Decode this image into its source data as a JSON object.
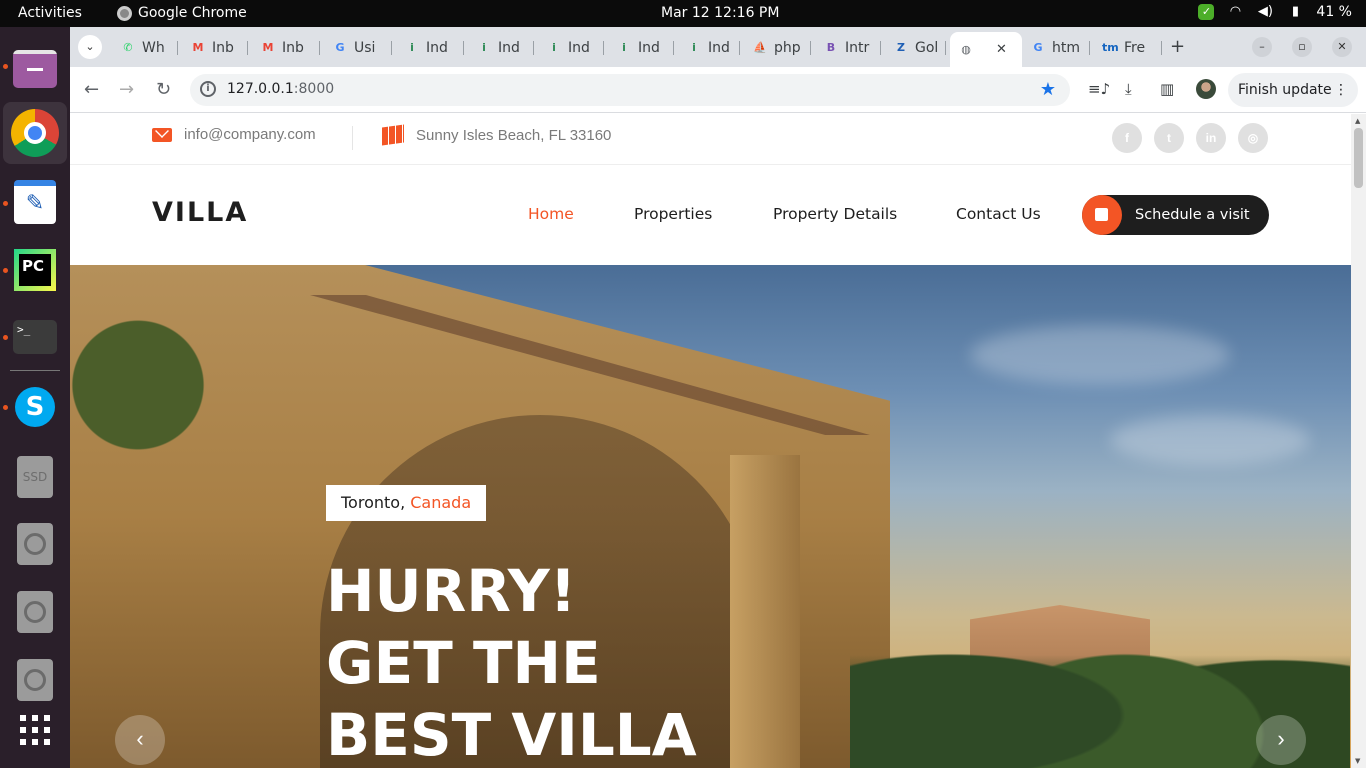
{
  "system": {
    "activities": "Activities",
    "app_name": "Google Chrome",
    "clock": "Mar 12  12:16 PM",
    "battery": "41 %"
  },
  "browser": {
    "tabs": [
      {
        "label": "Wh",
        "icon": "whatsapp-icon",
        "color": "#25d366"
      },
      {
        "label": "Inb",
        "icon": "gmail-icon",
        "color": "#ea4335"
      },
      {
        "label": "Inb",
        "icon": "gmail-icon",
        "color": "#ea4335"
      },
      {
        "label": "Usi",
        "icon": "google-icon",
        "color": "#4285f4"
      },
      {
        "label": "Ind",
        "icon": "indeed-icon",
        "color": "#2e8b57"
      },
      {
        "label": "Ind",
        "icon": "indeed-icon",
        "color": "#2e8b57"
      },
      {
        "label": "Ind",
        "icon": "indeed-icon",
        "color": "#2e8b57"
      },
      {
        "label": "Ind",
        "icon": "indeed-icon",
        "color": "#2e8b57"
      },
      {
        "label": "Ind",
        "icon": "indeed-icon",
        "color": "#2e8b57"
      },
      {
        "label": "php",
        "icon": "phpmyadmin-icon",
        "color": "#f29111"
      },
      {
        "label": "Intr",
        "icon": "bootstrap-icon",
        "color": "#7952b3"
      },
      {
        "label": "Gol",
        "icon": "golang-icon",
        "color": "#1f5fb5"
      },
      {
        "label": "",
        "icon": "globe-icon",
        "color": "#5f6368"
      },
      {
        "label": "htm",
        "icon": "google-icon",
        "color": "#4285f4"
      },
      {
        "label": "Fre",
        "icon": "templatemo-icon",
        "color": "#1565c0"
      }
    ],
    "url_host": "127.0.0.1",
    "url_port": ":8000",
    "finish_update": "Finish update"
  },
  "site": {
    "email": "info@company.com",
    "address": "Sunny Isles Beach, FL 33160",
    "socials": [
      "facebook-icon",
      "twitter-icon",
      "linkedin-icon",
      "instagram-icon"
    ],
    "logo": "VILLA",
    "nav": {
      "home": "Home",
      "properties": "Properties",
      "property_details": "Property Details",
      "contact": "Contact Us"
    },
    "schedule_button": "Schedule a visit",
    "hero": {
      "city": "Toronto,",
      "country": "Canada",
      "line1": "HURRY!",
      "line2": "GET THE",
      "line3": "BEST VILLA"
    },
    "accent_color": "#f35525"
  }
}
